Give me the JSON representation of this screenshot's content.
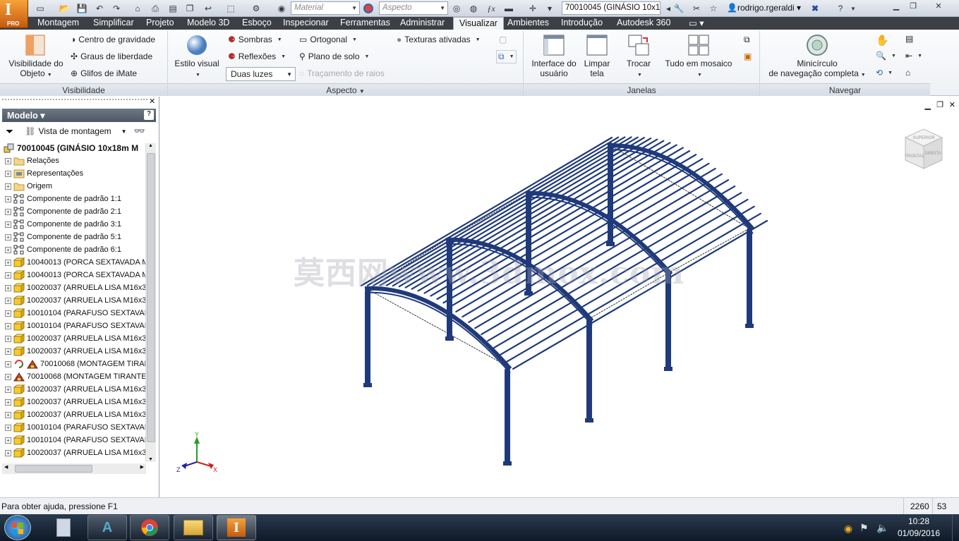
{
  "app": {
    "logo_letter": "I",
    "logo_sub": "PRO",
    "document_title": "70010045 (GINÁSIO 10x1...",
    "user_name": "rodrigo.rgeraldi",
    "material_placeholder": "Material",
    "appearance_placeholder": "Aspecto"
  },
  "tabs": [
    "Montagem",
    "Simplificar",
    "Projeto",
    "Modelo 3D",
    "Esboço",
    "Inspecionar",
    "Ferramentas",
    "Administrar",
    "Visualizar",
    "Ambientes",
    "Introdução",
    "Autodesk 360"
  ],
  "active_tab": "Visualizar",
  "ribbon": {
    "visibilidade": {
      "label": "Visibilidade",
      "visibilidade_objeto": "Visibilidade do\nObjeto",
      "centro_gravidade": "Centro de gravidade",
      "graus_liberdade": "Graus de liberdade",
      "glifos_imate": "Glifos de iMate"
    },
    "aspecto": {
      "label": "Aspecto",
      "estilo_visual": "Estilo visual",
      "sombras": "Sombras",
      "reflexoes": "Reflexões",
      "duas_luzes": "Duas luzes",
      "ortogonal": "Ortogonal",
      "plano_solo": "Plano de solo",
      "tracamento_raios": "Traçamento de raios",
      "texturas_ativadas": "Texturas ativadas"
    },
    "janelas": {
      "label": "Janelas",
      "interface_usuario": "Interface do\nusuário",
      "limpar_tela": "Limpar\ntela",
      "trocar": "Trocar",
      "tudo_mosaico": "Tudo em mosaico"
    },
    "navegar": {
      "label": "Navegar",
      "minicirculo": "Minicírculo\nde navegação completa"
    }
  },
  "browser": {
    "title": "Modelo",
    "view_label": "Vista de montagem",
    "items": [
      {
        "label": "70010045 (GINÁSIO 10x18m M",
        "icon": "assembly-icon",
        "root": true
      },
      {
        "label": "Relações",
        "icon": "folder-icon"
      },
      {
        "label": "Representações",
        "icon": "representations-icon"
      },
      {
        "label": "Origem",
        "icon": "folder-icon"
      },
      {
        "label": "Componente de padrão 1:1",
        "icon": "pattern-icon"
      },
      {
        "label": "Componente de padrão 2:1",
        "icon": "pattern-icon"
      },
      {
        "label": "Componente de padrão 3:1",
        "icon": "pattern-icon"
      },
      {
        "label": "Componente de padrão 5:1",
        "icon": "pattern-icon"
      },
      {
        "label": "Componente de padrão 6:1",
        "icon": "pattern-icon"
      },
      {
        "label": "10040013 (PORCA SEXTAVADA M",
        "icon": "part-icon"
      },
      {
        "label": "10040013 (PORCA SEXTAVADA M",
        "icon": "part-icon"
      },
      {
        "label": "10020037 (ARRUELA LISA M16x3",
        "icon": "part-icon"
      },
      {
        "label": "10020037 (ARRUELA LISA M16x3",
        "icon": "part-icon"
      },
      {
        "label": "10010104 (PARAFUSO SEXTAVAD",
        "icon": "part-icon"
      },
      {
        "label": "10010104 (PARAFUSO SEXTAVAD",
        "icon": "part-icon"
      },
      {
        "label": "10020037 (ARRUELA LISA M16x3",
        "icon": "part-icon"
      },
      {
        "label": "10020037 (ARRUELA LISA M16x3",
        "icon": "part-icon"
      },
      {
        "label": "70010068 (MONTAGEM TIRANT",
        "icon": "subassembly-icon",
        "extra": "refresh-icon"
      },
      {
        "label": "70010068 (MONTAGEM TIRANTE",
        "icon": "subassembly-icon"
      },
      {
        "label": "10020037 (ARRUELA LISA M16x3",
        "icon": "part-icon"
      },
      {
        "label": "10020037 (ARRUELA LISA M16x3",
        "icon": "part-icon"
      },
      {
        "label": "10020037 (ARRUELA LISA M16x3",
        "icon": "part-icon"
      },
      {
        "label": "10010104 (PARAFUSO SEXTAVAD",
        "icon": "part-icon"
      },
      {
        "label": "10010104 (PARAFUSO SEXTAVAD",
        "icon": "part-icon"
      },
      {
        "label": "10020037 (ARRUELA LISA M16x3",
        "icon": "part-icon"
      }
    ]
  },
  "viewport": {
    "watermark": "莫西网www.3dmox.com",
    "viewcube_faces": [
      "SUPERIOR",
      "FRONTAL",
      "DIREITA"
    ],
    "axis_labels": {
      "x": "X",
      "y": "Y",
      "z": "Z"
    },
    "model_color": "#1f3a7a"
  },
  "status": {
    "help_text": "Para obter ajuda, pressione F1",
    "count_a": "2260",
    "count_b": "53"
  },
  "taskbar": {
    "time": "10:28",
    "date": "01/09/2016",
    "apps": [
      "calculator-icon",
      "autocad-civil-icon",
      "chrome-icon",
      "explorer-icon",
      "inventor-icon"
    ]
  }
}
